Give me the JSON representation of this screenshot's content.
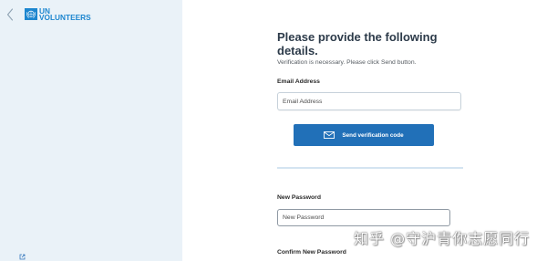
{
  "sidebar": {
    "back_icon": "chevron-left-icon",
    "logo": {
      "emblem_icon": "un-emblem-icon",
      "line1": "UN",
      "line2": "VOLUNTEERS"
    },
    "footer_icon": "external-link-icon"
  },
  "form": {
    "title": "Please provide the following details.",
    "subtitle": "Verification is necessary. Please click Send button.",
    "email": {
      "label": "Email Address",
      "placeholder": "Email Address",
      "value": ""
    },
    "send_button": {
      "icon": "envelope-icon",
      "label": "Send verification code"
    },
    "new_password": {
      "label": "New Password",
      "placeholder": "New Password",
      "value": ""
    },
    "confirm_password": {
      "label": "Confirm New Password"
    }
  },
  "watermark": "知乎 @守沪青你志愿同行",
  "colors": {
    "sidebar_background": "#eaf2f8",
    "brand_blue": "#1d86cf",
    "button_blue": "#2170b8",
    "divider": "#d4e4f1",
    "title_text": "#2d3b4a"
  }
}
